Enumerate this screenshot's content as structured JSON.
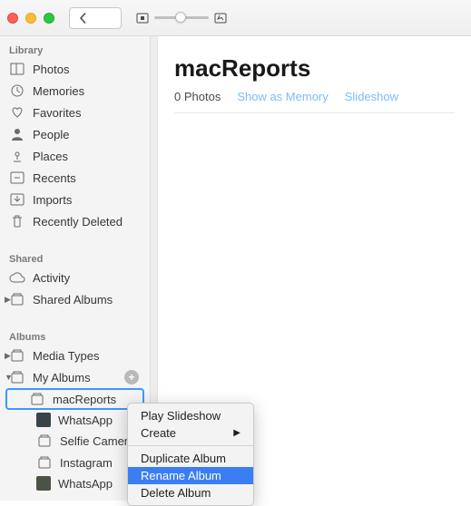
{
  "titlebar": {},
  "sidebar": {
    "sections": {
      "library": {
        "header": "Library",
        "items": [
          {
            "label": "Photos"
          },
          {
            "label": "Memories"
          },
          {
            "label": "Favorites"
          },
          {
            "label": "People"
          },
          {
            "label": "Places"
          },
          {
            "label": "Recents"
          },
          {
            "label": "Imports"
          },
          {
            "label": "Recently Deleted"
          }
        ]
      },
      "shared": {
        "header": "Shared",
        "items": [
          {
            "label": "Activity"
          },
          {
            "label": "Shared Albums"
          }
        ]
      },
      "albums": {
        "header": "Albums",
        "items": [
          {
            "label": "Media Types"
          },
          {
            "label": "My Albums"
          },
          {
            "label": "macReports"
          },
          {
            "label": "WhatsApp"
          },
          {
            "label": "Selfie Camera"
          },
          {
            "label": "Instagram"
          },
          {
            "label": "WhatsApp"
          }
        ]
      }
    }
  },
  "main": {
    "title": "macReports",
    "count": "0 Photos",
    "show_memory": "Show as Memory",
    "slideshow": "Slideshow"
  },
  "context_menu": {
    "items": [
      {
        "label": "Play Slideshow"
      },
      {
        "label": "Create",
        "submenu": true
      },
      {
        "label": "Duplicate Album"
      },
      {
        "label": "Rename Album",
        "hovered": true
      },
      {
        "label": "Delete Album"
      }
    ]
  }
}
